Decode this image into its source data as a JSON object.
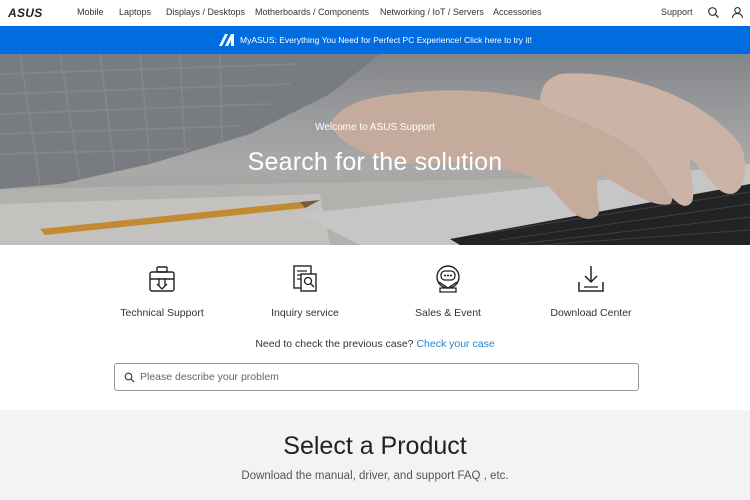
{
  "brand": {
    "logo_text": "ASUS"
  },
  "nav": {
    "items": [
      {
        "label": "Mobile"
      },
      {
        "label": "Laptops"
      },
      {
        "label": "Displays / Desktops"
      },
      {
        "label": "Motherboards / Components"
      },
      {
        "label": "Networking / IoT / Servers"
      },
      {
        "label": "Accessories"
      }
    ],
    "support_label": "Support",
    "icons": [
      "search-icon",
      "account-icon"
    ]
  },
  "banner": {
    "text": "MyASUS: Everything You Need for Perfect PC Experience! Click here to try it!",
    "color": "#006ce1"
  },
  "hero": {
    "subtitle": "Welcome to ASUS Support",
    "title": "Search for the solution"
  },
  "services": [
    {
      "label": "Technical Support",
      "icon": "technical-support-icon"
    },
    {
      "label": "Inquiry service",
      "icon": "inquiry-service-icon"
    },
    {
      "label": "Sales & Event",
      "icon": "sales-event-icon"
    },
    {
      "label": "Download Center",
      "icon": "download-center-icon"
    }
  ],
  "previous_case": {
    "text": "Need to check the previous case?",
    "link": "Check your case",
    "link_color": "#1c86d2"
  },
  "search": {
    "placeholder": "Please describe your problem",
    "value": ""
  },
  "select_product": {
    "title": "Select a Product",
    "subtitle": "Download the manual, driver, and support FAQ , etc."
  }
}
